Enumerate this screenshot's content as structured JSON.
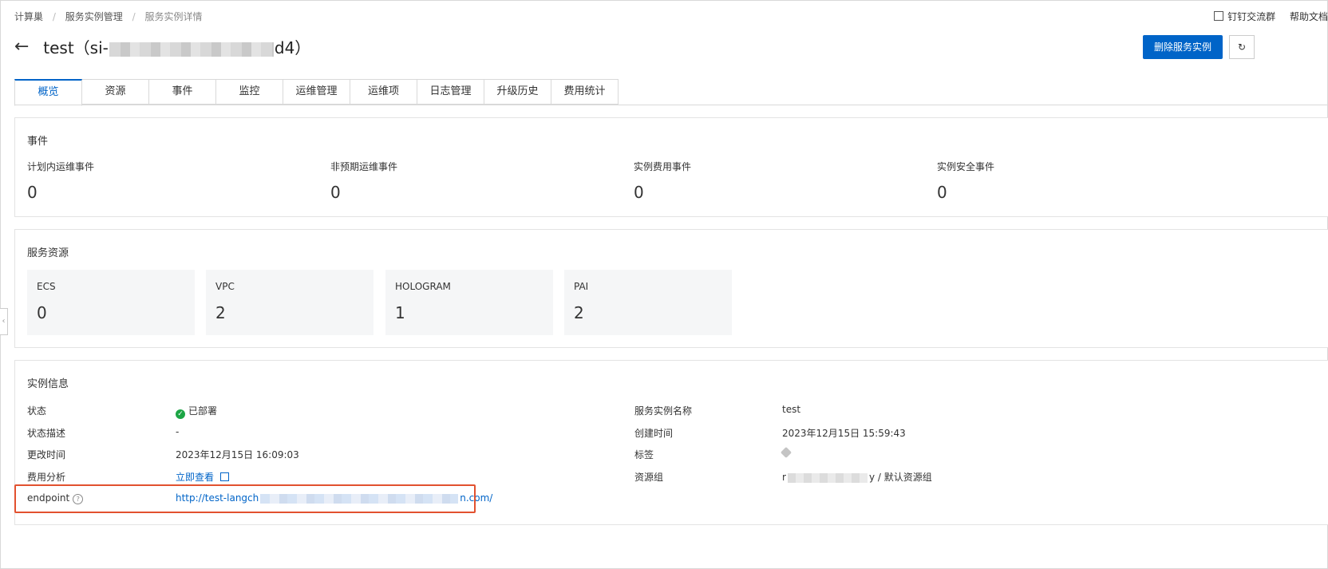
{
  "breadcrumb": {
    "items": [
      "计算巢",
      "服务实例管理",
      "服务实例详情"
    ],
    "sep": "/"
  },
  "topright": {
    "dingtalk": "钉钉交流群",
    "help": "帮助文档"
  },
  "header": {
    "title_prefix": "test（si-",
    "title_suffix": "d4）",
    "back_icon": "←"
  },
  "actions": {
    "delete_label": "删除服务实例",
    "refresh_icon": "↻"
  },
  "tabs": [
    "概览",
    "资源",
    "事件",
    "监控",
    "运维管理",
    "运维项",
    "日志管理",
    "升级历史",
    "费用统计"
  ],
  "events": {
    "title": "事件",
    "items": [
      {
        "label": "计划内运维事件",
        "value": "0"
      },
      {
        "label": "非预期运维事件",
        "value": "0"
      },
      {
        "label": "实例费用事件",
        "value": "0"
      },
      {
        "label": "实例安全事件",
        "value": "0"
      }
    ]
  },
  "resources": {
    "title": "服务资源",
    "items": [
      {
        "label": "ECS",
        "value": "0"
      },
      {
        "label": "VPC",
        "value": "2"
      },
      {
        "label": "HOLOGRAM",
        "value": "1"
      },
      {
        "label": "PAI",
        "value": "2"
      }
    ]
  },
  "info": {
    "title": "实例信息",
    "status_key": "状态",
    "status_value": "已部署",
    "desc_key": "状态描述",
    "desc_value": "-",
    "modified_key": "更改时间",
    "modified_value": "2023年12月15日 16:09:03",
    "cost_key": "费用分析",
    "cost_value": "立即查看",
    "endpoint_key": "endpoint",
    "endpoint_prefix": "http://test-langch",
    "endpoint_suffix": "n.com/",
    "name_key": "服务实例名称",
    "name_value": "test",
    "created_key": "创建时间",
    "created_value": "2023年12月15日 15:59:43",
    "tags_key": "标签",
    "rg_key": "资源组",
    "rg_prefix": "r",
    "rg_suffix": "y / 默认资源组"
  }
}
